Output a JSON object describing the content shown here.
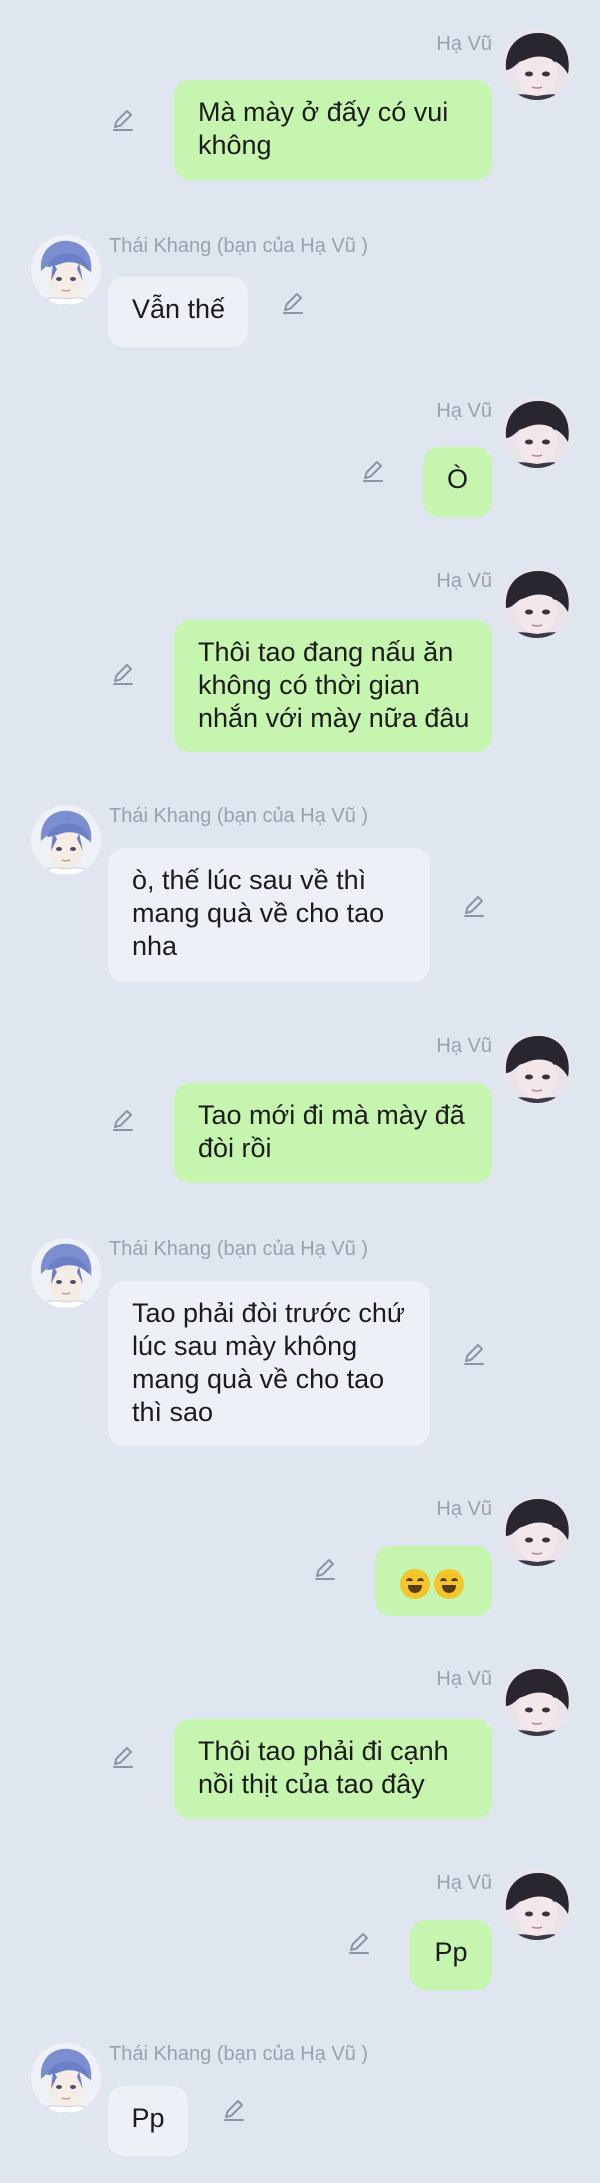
{
  "colors": {
    "background": "#dfe6f0",
    "sent_bubble": "#c5f5ae",
    "received_bubble": "#edf1f7",
    "name_text": "#98a2ae"
  },
  "participants": {
    "me": "Hạ Vũ",
    "other": "Thái Khang (bạn của Hạ Vũ )"
  },
  "messages": [
    {
      "sender": "me",
      "lines": [
        "Mà mày ở đấy có vui",
        "không"
      ]
    },
    {
      "sender": "other",
      "lines": [
        "Vẫn thế"
      ]
    },
    {
      "sender": "me",
      "lines": [
        "Ò"
      ]
    },
    {
      "sender": "me",
      "lines": [
        "Thôi tao đang nấu ăn",
        "không có thời gian",
        "nhắn với mày nữa đâu"
      ]
    },
    {
      "sender": "other",
      "lines": [
        "ò, thế lúc sau về thì",
        "mang quà về cho tao",
        "nha"
      ]
    },
    {
      "sender": "me",
      "lines": [
        "Tao mới đi mà mày đã",
        "đòi rồi"
      ]
    },
    {
      "sender": "other",
      "lines": [
        "Tao phải đòi trước chứ",
        "lúc sau mày không",
        "mang quà về cho tao",
        "thì sao"
      ]
    },
    {
      "sender": "me",
      "emoji": "rolling-on-floor-laughing x2"
    },
    {
      "sender": "me",
      "lines": [
        "Thôi tao phải đi cạnh",
        "nồi thịt của tao đây"
      ]
    },
    {
      "sender": "me",
      "lines": [
        "Pp"
      ]
    },
    {
      "sender": "other",
      "lines": [
        "Pp"
      ]
    }
  ]
}
